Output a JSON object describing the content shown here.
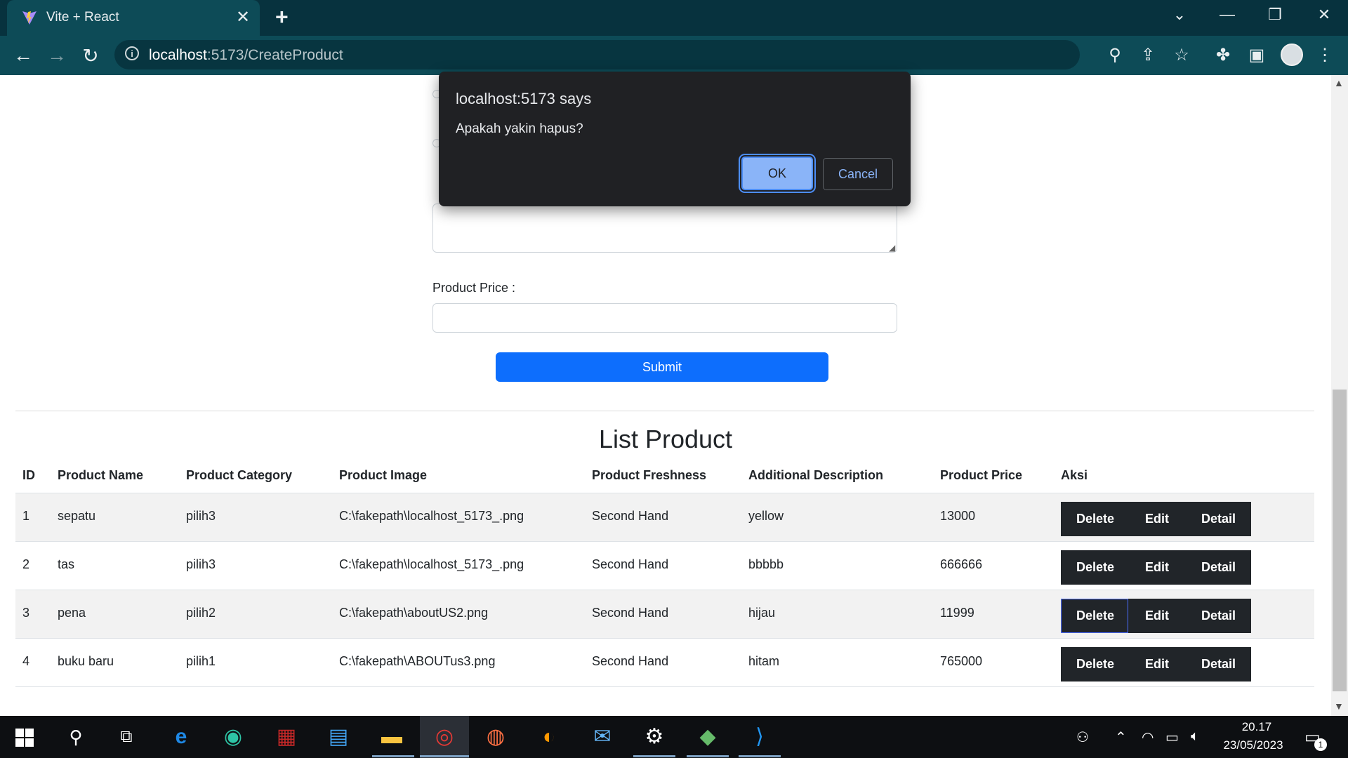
{
  "browser": {
    "tab_title": "Vite + React",
    "url_host": "localhost",
    "url_path": ":5173/CreateProduct"
  },
  "form": {
    "price_label": "Product Price :",
    "submit_label": "Submit"
  },
  "list": {
    "title": "List Product",
    "headers": [
      "ID",
      "Product Name",
      "Product Category",
      "Product Image",
      "Product Freshness",
      "Additional Description",
      "Product Price",
      "Aksi"
    ],
    "rows": [
      {
        "id": "1",
        "name": "sepatu",
        "category": "pilih3",
        "image": "C:\\fakepath\\localhost_5173_.png",
        "freshness": "Second Hand",
        "description": "yellow",
        "price": "13000"
      },
      {
        "id": "2",
        "name": "tas",
        "category": "pilih3",
        "image": "C:\\fakepath\\localhost_5173_.png",
        "freshness": "Second Hand",
        "description": "bbbbb",
        "price": "666666"
      },
      {
        "id": "3",
        "name": "pena",
        "category": "pilih2",
        "image": "C:\\fakepath\\aboutUS2.png",
        "freshness": "Second Hand",
        "description": "hijau",
        "price": "11999"
      },
      {
        "id": "4",
        "name": "buku baru",
        "category": "pilih1",
        "image": "C:\\fakepath\\ABOUTus3.png",
        "freshness": "Second Hand",
        "description": "hitam",
        "price": "765000"
      }
    ],
    "actions": {
      "delete": "Delete",
      "edit": "Edit",
      "detail": "Detail"
    }
  },
  "dialog": {
    "title": "localhost:5173 says",
    "message": "Apakah yakin hapus?",
    "ok": "OK",
    "cancel": "Cancel"
  },
  "taskbar": {
    "time": "20.17",
    "date": "23/05/2023",
    "notification_count": "1"
  },
  "colors": {
    "primary_button": "#0d6efd",
    "action_button": "#212529",
    "dialog_bg": "#202124",
    "dialog_accent": "#8ab4f8",
    "browser_frame": "#0d4b57"
  }
}
